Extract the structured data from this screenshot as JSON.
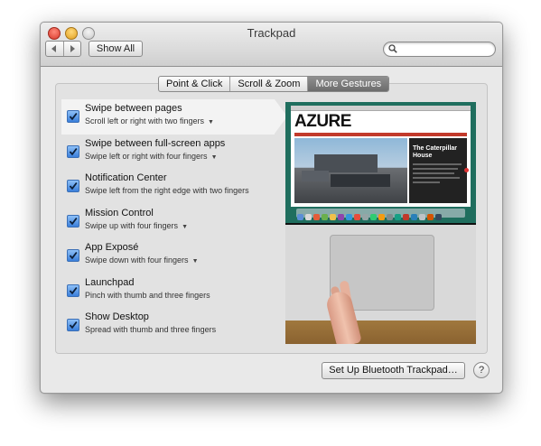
{
  "window": {
    "title": "Trackpad"
  },
  "toolbar": {
    "back_icon": "chevron-left-icon",
    "forward_icon": "chevron-right-icon",
    "show_all_label": "Show All",
    "search_value": "",
    "search_placeholder": "",
    "search_icon": "magnifier-icon"
  },
  "tabs": [
    {
      "label": "Point & Click",
      "selected": false
    },
    {
      "label": "Scroll & Zoom",
      "selected": false
    },
    {
      "label": "More Gestures",
      "selected": true
    }
  ],
  "gestures": [
    {
      "title": "Swipe between pages",
      "subtitle": "Scroll left or right with two fingers",
      "has_dropdown": true,
      "checked": true,
      "selected": true
    },
    {
      "title": "Swipe between full-screen apps",
      "subtitle": "Swipe left or right with four fingers",
      "has_dropdown": true,
      "checked": true,
      "selected": false
    },
    {
      "title": "Notification Center",
      "subtitle": "Swipe left from the right edge with two fingers",
      "has_dropdown": false,
      "checked": true,
      "selected": false
    },
    {
      "title": "Mission Control",
      "subtitle": "Swipe up with four fingers",
      "has_dropdown": true,
      "checked": true,
      "selected": false
    },
    {
      "title": "App Exposé",
      "subtitle": "Swipe down with four fingers",
      "has_dropdown": true,
      "checked": true,
      "selected": false
    },
    {
      "title": "Launchpad",
      "subtitle": "Pinch with thumb and three fingers",
      "has_dropdown": false,
      "checked": true,
      "selected": false
    },
    {
      "title": "Show Desktop",
      "subtitle": "Spread with thumb and three fingers",
      "has_dropdown": false,
      "checked": true,
      "selected": false
    }
  ],
  "preview": {
    "site_logo": "AZURE",
    "article_title": "The Caterpillar House"
  },
  "footer": {
    "setup_label": "Set Up Bluetooth Trackpad…",
    "help_label": "?"
  },
  "colors": {
    "accent": "#3a7fdb",
    "selected_tab": "#7a7a7a",
    "close": "#e0443a",
    "minimize": "#e7a62a"
  }
}
